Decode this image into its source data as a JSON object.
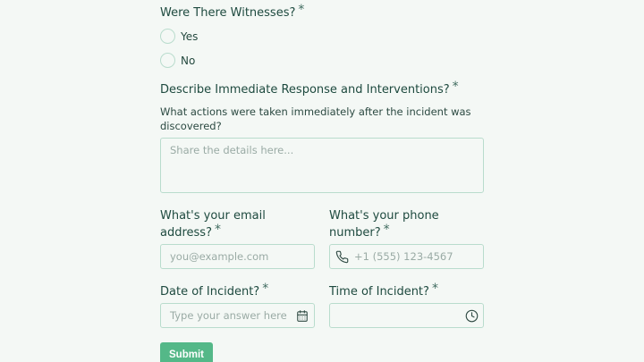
{
  "witnesses": {
    "question": "Were There Witnesses?",
    "required_mark": "*",
    "options": [
      "Yes",
      "No"
    ]
  },
  "response": {
    "question": "Describe Immediate Response and Interventions?",
    "required_mark": "*",
    "helper_line1": "What actions were taken immediately after the incident was",
    "helper_line2": "discovered?",
    "placeholder": "Share the details here..."
  },
  "email": {
    "question_line1": "What's your email",
    "question_line2": "address?",
    "required_mark": "*",
    "placeholder": "you@example.com"
  },
  "phone": {
    "question_line1": "What's your phone",
    "question_line2": "number?",
    "required_mark": "*",
    "placeholder": "+1 (555) 123-4567",
    "icon": "phone-icon"
  },
  "date": {
    "question": "Date of Incident?",
    "required_mark": "*",
    "placeholder": "Type your answer here",
    "icon": "calendar-icon"
  },
  "time": {
    "question": "Time of Incident?",
    "required_mark": "*",
    "placeholder": "",
    "icon": "clock-icon"
  },
  "submit": {
    "label": "Submit"
  },
  "colors": {
    "accent": "#54b888",
    "border": "#b9dccd",
    "text": "#1e4a3f",
    "background": "#f4f8f5"
  }
}
